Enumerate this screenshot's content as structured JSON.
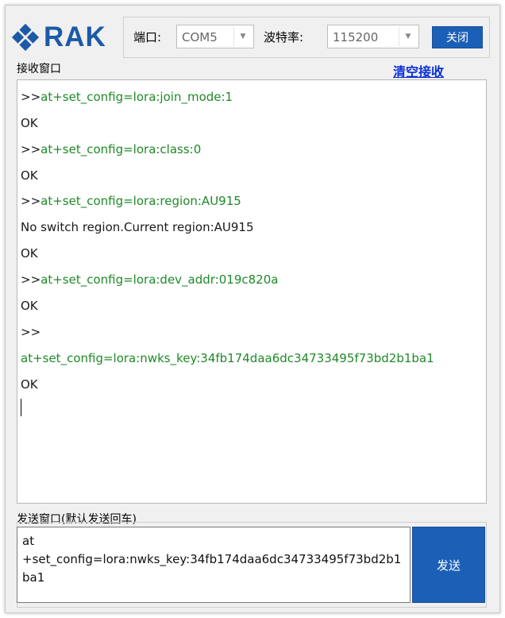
{
  "brand": {
    "name": "RAK"
  },
  "header": {
    "port_label": "端口:",
    "port_value": "COM5",
    "baud_label": "波特率:",
    "baud_value": "115200",
    "close_button": "关闭"
  },
  "receive": {
    "title": "接收窗口",
    "clear_link": "清空接收",
    "lines": [
      {
        "text": ">>",
        "kind": "prompt"
      },
      {
        "text": "at+set_config=lora:join_mode:1",
        "kind": "command"
      },
      {
        "text": "OK",
        "kind": "response"
      },
      {
        "text": ">>",
        "kind": "prompt"
      },
      {
        "text": "at+set_config=lora:class:0",
        "kind": "command"
      },
      {
        "text": "OK",
        "kind": "response"
      },
      {
        "text": ">>",
        "kind": "prompt"
      },
      {
        "text": "at+set_config=lora:region:AU915",
        "kind": "command"
      },
      {
        "text": "No switch region.Current region:AU915",
        "kind": "response"
      },
      {
        "text": "OK",
        "kind": "response"
      },
      {
        "text": ">>",
        "kind": "prompt"
      },
      {
        "text": "at+set_config=lora:dev_addr:019c820a",
        "kind": "command"
      },
      {
        "text": "OK",
        "kind": "response"
      },
      {
        "text": ">>",
        "kind": "prompt"
      },
      {
        "text": "at+set_config=lora:nwks_key:34fb174daa6dc34733495f73bd2b1ba1",
        "kind": "command"
      },
      {
        "text": "OK",
        "kind": "response"
      }
    ]
  },
  "send": {
    "title": "发送窗口(默认发送回车)",
    "input_value": "at\n+set_config=lora:nwks_key:34fb174daa6dc34733495f73bd2b1ba1",
    "send_button": "发送"
  },
  "colors": {
    "accent": "#1c5fb6",
    "command": "#1f8a28",
    "link": "#0a2fd6"
  },
  "icons": {
    "logo": "rak-logo-icon",
    "dropdown": "chevron-down-icon"
  }
}
